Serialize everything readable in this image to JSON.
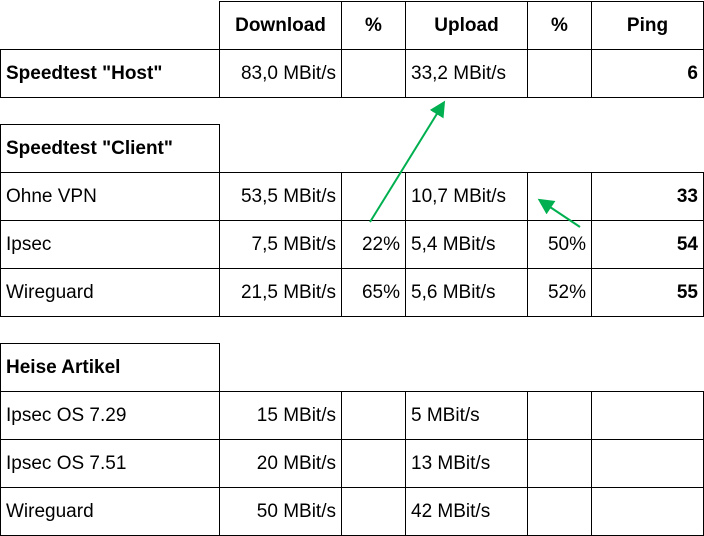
{
  "header": {
    "download": "Download",
    "pct1": "%",
    "upload": "Upload",
    "pct2": "%",
    "ping": "Ping"
  },
  "host": {
    "label": "Speedtest \"Host\"",
    "download": "83,0 MBit/s",
    "pct1": "",
    "upload": "33,2 MBit/s",
    "pct2": "",
    "ping": "6"
  },
  "client": {
    "title": "Speedtest \"Client\"",
    "rows": [
      {
        "label": "Ohne VPN",
        "download": "53,5 MBit/s",
        "pct1": "",
        "upload": "10,7 MBit/s",
        "pct2": "",
        "ping": "33"
      },
      {
        "label": "Ipsec",
        "download": "7,5 MBit/s",
        "pct1": "22%",
        "upload": "5,4 MBit/s",
        "pct2": "50%",
        "ping": "54"
      },
      {
        "label": "Wireguard",
        "download": "21,5 MBit/s",
        "pct1": "65%",
        "upload": "5,6 MBit/s",
        "pct2": "52%",
        "ping": "55"
      }
    ]
  },
  "heise": {
    "title": "Heise Artikel",
    "rows": [
      {
        "label": "Ipsec OS 7.29",
        "download": "15 MBit/s",
        "pct1": "",
        "upload": "5 MBit/s",
        "pct2": "",
        "ping": ""
      },
      {
        "label": "Ipsec OS 7.51",
        "download": "20 MBit/s",
        "pct1": "",
        "upload": "13 MBit/s",
        "pct2": "",
        "ping": ""
      },
      {
        "label": "Wireguard",
        "download": "50 MBit/s",
        "pct1": "",
        "upload": "42 MBit/s",
        "pct2": "",
        "ping": ""
      }
    ]
  },
  "colors": {
    "arrow": "#00b050"
  }
}
